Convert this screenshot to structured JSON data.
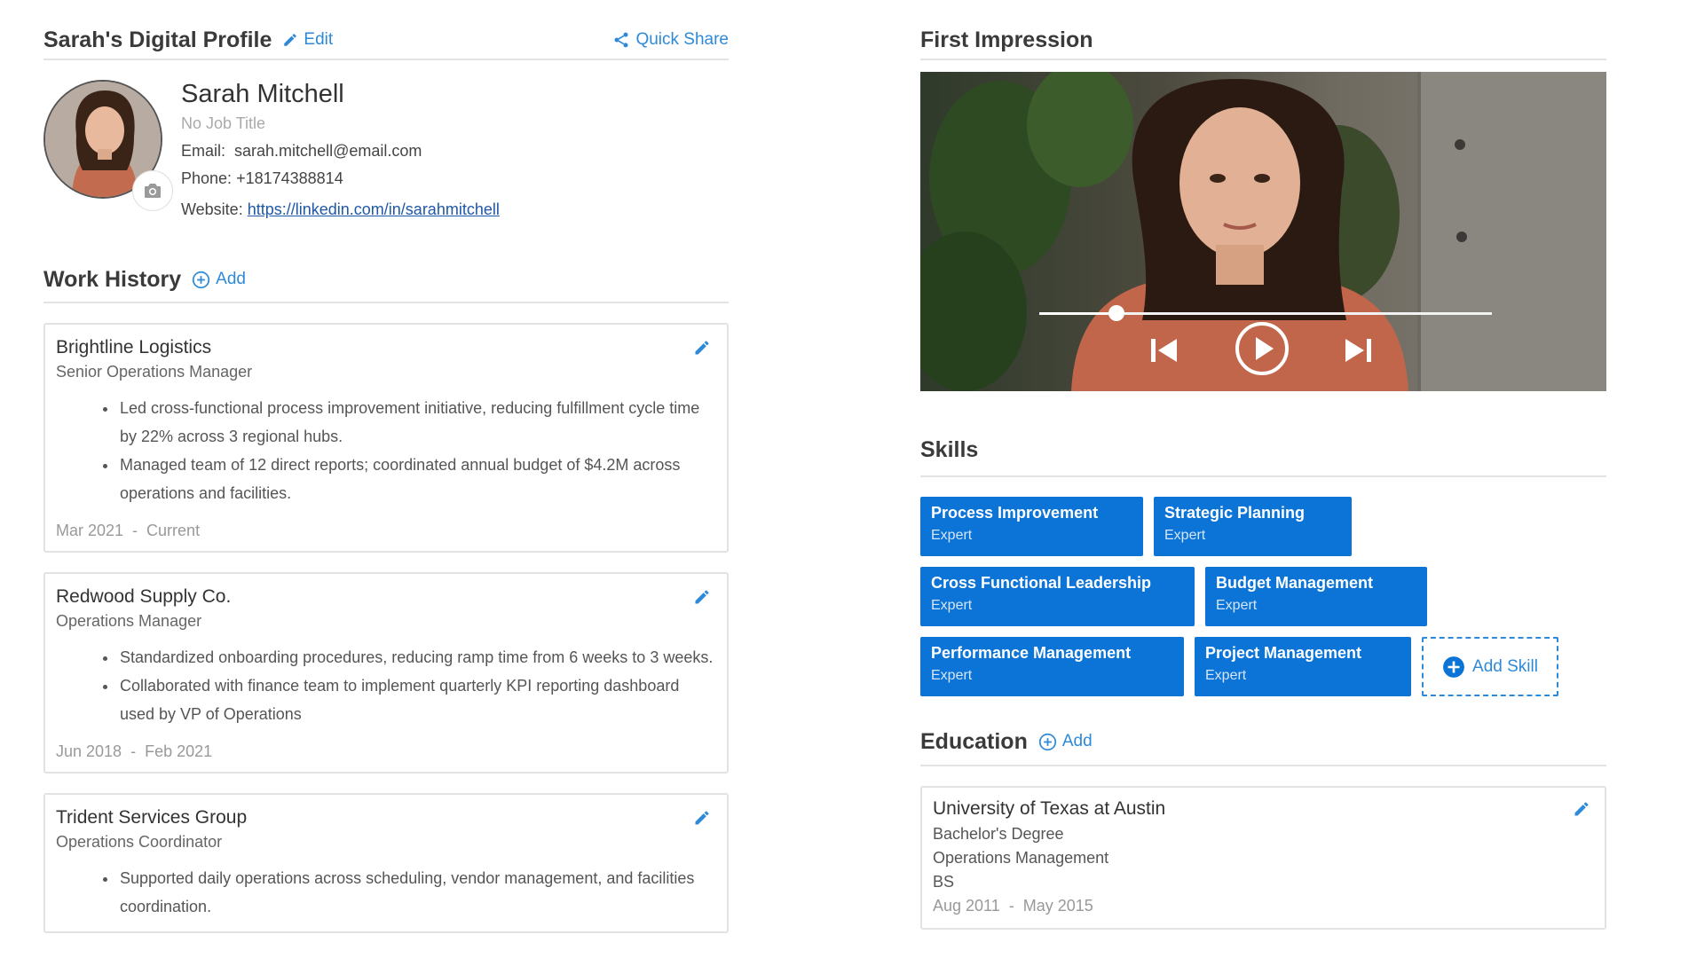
{
  "profile": {
    "header_title": "Sarah's Digital Profile",
    "edit_label": "Edit",
    "quick_share_label": "Quick Share",
    "name": "Sarah Mitchell",
    "job_title": "No Job Title",
    "email_label": "Email:",
    "email": "sarah.mitchell@email.com",
    "phone_label": "Phone:",
    "phone": "+18174388814",
    "website_label": "Website:",
    "website": "https://linkedin.com/in/sarahmitchell"
  },
  "work_history": {
    "title": "Work History",
    "add_label": "Add",
    "jobs": [
      {
        "company": "Brightline Logistics",
        "role": "Senior Operations Manager",
        "bullets": [
          "Led cross-functional process improvement initiative, reducing fulfillment cycle time by 22% across 3 regional hubs.",
          "Managed team of 12 direct reports; coordinated annual budget of $4.2M across operations and facilities."
        ],
        "start": "Mar 2021",
        "end": "Current"
      },
      {
        "company": "Redwood Supply Co.",
        "role": "Operations Manager",
        "bullets": [
          "Standardized onboarding procedures, reducing ramp time from 6 weeks to 3 weeks.",
          "Collaborated with finance team to implement quarterly KPI reporting dashboard used by VP of Operations"
        ],
        "start": "Jun 2018",
        "end": "Feb 2021"
      },
      {
        "company": "Trident Services Group",
        "role": "Operations Coordinator",
        "bullets": [
          "Supported daily operations across scheduling, vendor management, and facilities coordination."
        ],
        "start": "",
        "end": ""
      }
    ]
  },
  "first_impression": {
    "title": "First Impression",
    "progress": 0.17
  },
  "skills": {
    "title": "Skills",
    "add_skill_label": "Add Skill",
    "rows": [
      [
        {
          "name": "Process Improvement",
          "level": "Expert"
        },
        {
          "name": "Strategic Planning",
          "level": "Expert"
        }
      ],
      [
        {
          "name": "Cross Functional Leadership",
          "level": "Expert"
        },
        {
          "name": "Budget Management",
          "level": "Expert"
        }
      ],
      [
        {
          "name": "Performance Management",
          "level": "Expert"
        },
        {
          "name": "Project Management",
          "level": "Expert"
        }
      ]
    ]
  },
  "education": {
    "title": "Education",
    "add_label": "Add",
    "items": [
      {
        "school": "University of Texas at Austin",
        "degree": "Bachelor's Degree",
        "field": "Operations Management",
        "abbrev": "BS",
        "start": "Aug 2011",
        "end": "May 2015"
      }
    ]
  },
  "icons": {
    "edit": "pencil-icon",
    "share": "share-icon",
    "add": "plus-circle-icon",
    "camera": "camera-icon",
    "play": "play-icon",
    "prev": "skip-back-icon",
    "next": "skip-forward-icon"
  },
  "colors": {
    "accent": "#2e8ad8",
    "chip": "#0c74d6",
    "link": "#1e58a6"
  }
}
